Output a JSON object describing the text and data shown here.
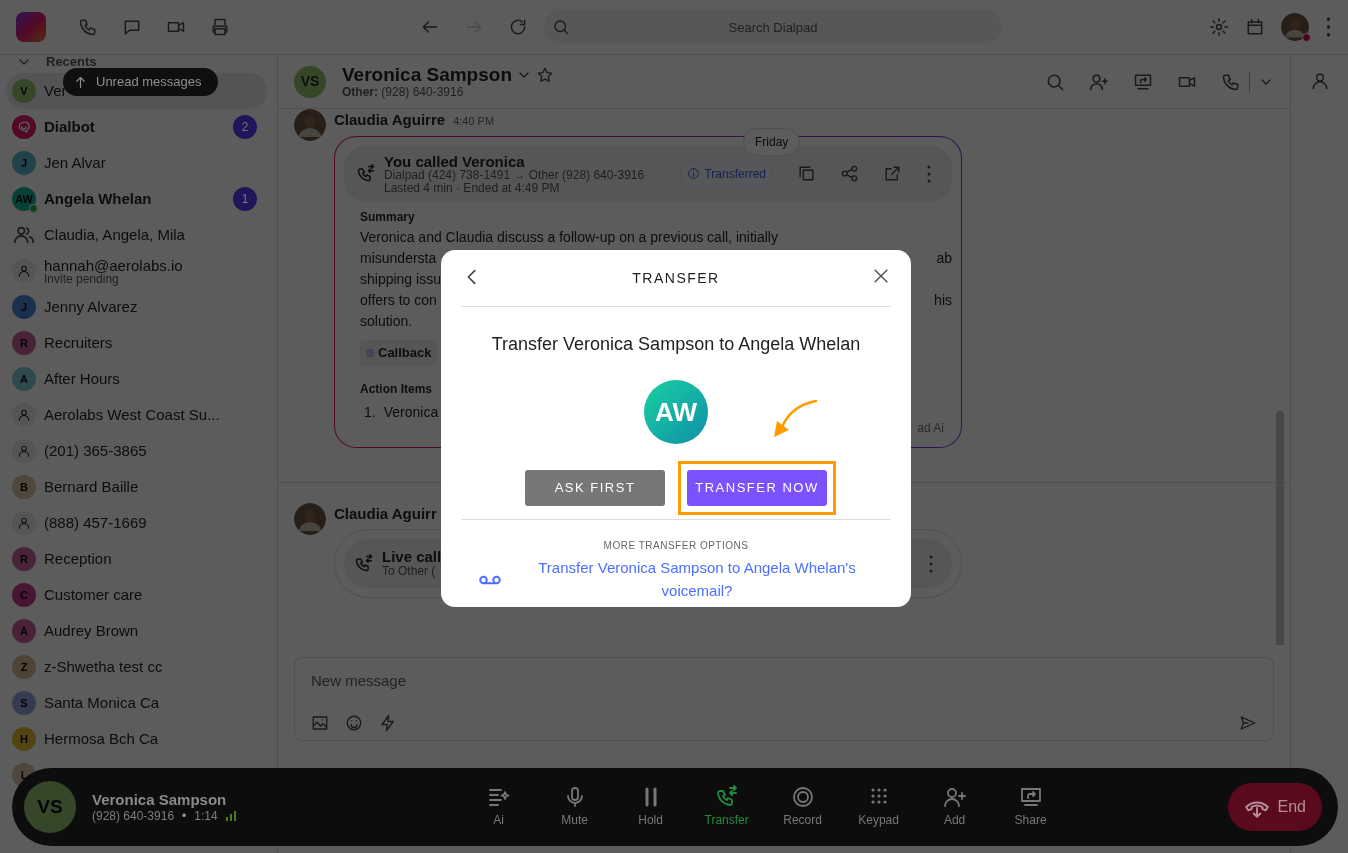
{
  "top_bar": {
    "search": {
      "placeholder": "Search Dialpad"
    }
  },
  "sidebar": {
    "section": "Recents",
    "tooltip": "Unread messages",
    "items": [
      {
        "name": "Ver",
        "avatar": {
          "kind": "letter",
          "letter": "V",
          "color": "#354728"
        },
        "unread": false,
        "selected": true,
        "online": false
      },
      {
        "name": "Dialbot",
        "avatar": {
          "kind": "bot",
          "color": "#510927"
        },
        "unread": true,
        "badge": "2",
        "selected": false,
        "online": false
      },
      {
        "name": "Jen Alvar",
        "avatar": {
          "kind": "letter",
          "letter": "J",
          "color": "#1f424b"
        },
        "unread": false,
        "selected": false,
        "online": false
      },
      {
        "name": "Angela Whelan",
        "avatar": {
          "kind": "letter",
          "letter": "AW",
          "color": "#074037"
        },
        "unread": true,
        "badge": "1",
        "selected": false,
        "online": true
      },
      {
        "name": "Claudia, Angela, Mila",
        "avatar": {
          "kind": "group"
        },
        "unread": false,
        "selected": false,
        "online": false
      },
      {
        "name": "hannah@aerolabs.io",
        "sub": "Invite pending",
        "avatar": {
          "kind": "person"
        },
        "unread": false,
        "selected": false,
        "online": false
      },
      {
        "name": "Jenny Alvarez",
        "avatar": {
          "kind": "letter",
          "letter": "J",
          "color": "#1b304e"
        },
        "unread": false,
        "selected": false,
        "online": false
      },
      {
        "name": "Recruiters",
        "avatar": {
          "kind": "letter",
          "letter": "R",
          "color": "#482338"
        },
        "unread": false,
        "selected": false,
        "online": false
      },
      {
        "name": "After Hours",
        "avatar": {
          "kind": "letter",
          "letter": "A",
          "color": "#2f4a4f"
        },
        "unread": false,
        "selected": false,
        "online": false
      },
      {
        "name": "Aerolabs West Coast Su...",
        "avatar": {
          "kind": "person"
        },
        "unread": false,
        "selected": false,
        "online": false
      },
      {
        "name": "(201) 365-3865",
        "avatar": {
          "kind": "person"
        },
        "unread": false,
        "selected": false,
        "online": false
      },
      {
        "name": "Bernard Baille",
        "avatar": {
          "kind": "letter",
          "letter": "B",
          "color": "#4f473c"
        },
        "unread": false,
        "selected": false,
        "online": false
      },
      {
        "name": "(888) 457-1669",
        "avatar": {
          "kind": "person"
        },
        "unread": false,
        "selected": false,
        "online": false
      },
      {
        "name": "Reception",
        "avatar": {
          "kind": "letter",
          "letter": "R",
          "color": "#482339"
        },
        "unread": false,
        "selected": false,
        "online": false
      },
      {
        "name": "Customer care",
        "avatar": {
          "kind": "letter",
          "letter": "C",
          "color": "#471634"
        },
        "unread": false,
        "selected": false,
        "online": false
      },
      {
        "name": "Audrey Brown",
        "avatar": {
          "kind": "letter",
          "letter": "A",
          "color": "#492139"
        },
        "unread": false,
        "selected": false,
        "online": false
      },
      {
        "name": "z-Shwetha test cc",
        "avatar": {
          "kind": "letter",
          "letter": "Z",
          "color": "#4e4335"
        },
        "unread": false,
        "selected": false,
        "online": false
      },
      {
        "name": "Santa Monica Ca",
        "avatar": {
          "kind": "letter",
          "letter": "S",
          "color": "#353c52"
        },
        "unread": false,
        "selected": false,
        "online": false
      },
      {
        "name": "Hermosa Bch Ca",
        "avatar": {
          "kind": "letter",
          "letter": "H",
          "color": "#534512"
        },
        "unread": false,
        "selected": false,
        "online": false
      },
      {
        "avatar": {
          "kind": "letter",
          "letter": "L",
          "color": "#4f473b"
        },
        "selected": false,
        "online": false
      }
    ]
  },
  "conversation": {
    "contact": {
      "initials": "VS",
      "name": "Veronica Sampson",
      "line_label": "Other:",
      "phone": "(928) 640-3916"
    },
    "messages": [
      {
        "author": "Claudia Aguirre",
        "time": "4:40 PM",
        "date_pill": "Friday",
        "call": {
          "title": "You called Veronica",
          "route": "Dialpad (424) 738-1491 → Other (928) 640-3916",
          "details": "Lasted 4 min · Ended at 4:49 PM",
          "status": "Transferred"
        },
        "summary_heading": "Summary",
        "summary_lines": [
          {
            "left": "Veronica and Claudia discuss a follow-up on a previous call, initially"
          },
          {
            "left": "misundersta",
            "right": "ab"
          },
          {
            "left": "shipping issu"
          },
          {
            "left": "offers to con",
            "right": "his"
          },
          {
            "left": "solution."
          }
        ],
        "tag": "Callback",
        "action_heading": "Action Items",
        "actions": [
          {
            "number": "1.",
            "text": "Veronica"
          }
        ],
        "footer_fragment": "ad Ai"
      },
      {
        "author": "Claudia Aguirr",
        "call": {
          "title": "Live call",
          "route": "To Other ("
        }
      }
    ]
  },
  "composer": {
    "placeholder": "New message"
  },
  "call_bar": {
    "initials": "VS",
    "name": "Veronica Sampson",
    "phone": "(928) 640-3916",
    "separator": "•",
    "duration": "1:14",
    "controls": [
      {
        "kind": "ai",
        "label": "Ai",
        "active": false
      },
      {
        "kind": "mute",
        "label": "Mute",
        "active": false
      },
      {
        "kind": "hold",
        "label": "Hold",
        "active": false
      },
      {
        "kind": "transfer",
        "label": "Transfer",
        "active": true
      },
      {
        "kind": "record",
        "label": "Record",
        "active": false
      },
      {
        "kind": "keypad",
        "label": "Keypad",
        "active": false
      },
      {
        "kind": "add",
        "label": "Add",
        "active": false
      },
      {
        "kind": "share",
        "label": "Share",
        "active": false
      }
    ],
    "end_label": "End"
  },
  "modal": {
    "title": "TRANSFER",
    "heading": "Transfer Veronica Sampson to Angela Whelan",
    "initials": "AW",
    "buttons": [
      {
        "label": "ASK FIRST",
        "kind": "secondary",
        "highlighted": false
      },
      {
        "label": "TRANSFER NOW",
        "kind": "primary",
        "highlighted": true
      }
    ],
    "more_label": "MORE TRANSFER OPTIONS",
    "voicemail_link": "Transfer Veronica Sampson to Angela Whelan's voicemail?"
  }
}
